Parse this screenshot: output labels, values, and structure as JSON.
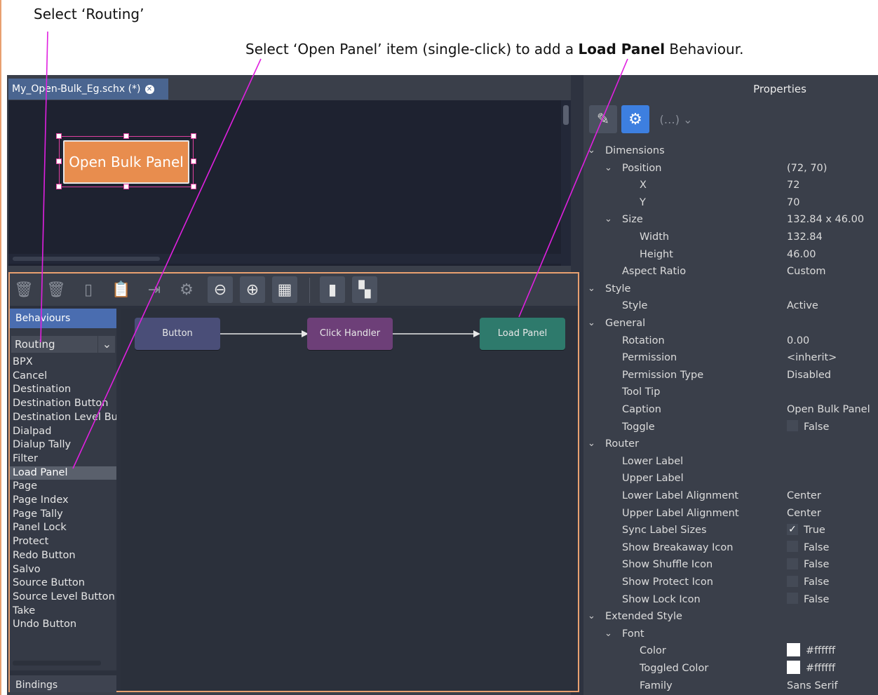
{
  "annotations": {
    "select_routing": "Select ‘Routing’",
    "select_open_panel_prefix": "Select ‘Open Panel’ item (single-click) to add a ",
    "select_open_panel_bold": "Load Panel",
    "select_open_panel_suffix": " Behaviour."
  },
  "document_tab": {
    "title": "My_Open-Bulk_Eg.schx (*)",
    "close_icon": "close-icon"
  },
  "canvas": {
    "button_caption": "Open Bulk Panel"
  },
  "toolbar": {
    "icons": [
      "trash-icon",
      "trash-clock-icon",
      "copy-icon",
      "paste-icon",
      "export-icon",
      "gear-icon",
      "zoom-out-icon",
      "zoom-in-icon",
      "fit-grid-icon",
      "align-icon",
      "window-icon"
    ]
  },
  "behaviours": {
    "tab_label": "Behaviours",
    "category": "Routing",
    "items": [
      "BPX",
      "Cancel",
      "Destination",
      "Destination Button",
      "Destination Level Butt",
      "Dialpad",
      "Dialup Tally",
      "Filter",
      "Load Panel",
      "Page",
      "Page Index",
      "Page Tally",
      "Panel Lock",
      "Protect",
      "Redo Button",
      "Salvo",
      "Source Button",
      "Source Level Button",
      "Take",
      "Undo Button"
    ],
    "selected": "Load Panel",
    "bindings_label": "Bindings"
  },
  "graph": {
    "nodes": [
      {
        "label": "Button",
        "color": "#4a4e78"
      },
      {
        "label": "Click Handler",
        "color": "#6d3f78"
      },
      {
        "label": "Load Panel",
        "color": "#2e7a6c"
      }
    ]
  },
  "properties": {
    "title": "Properties",
    "rows": [
      {
        "label": "Dimensions",
        "level": 0,
        "group": true,
        "value": ""
      },
      {
        "label": "Position",
        "level": 1,
        "group": true,
        "value": "(72, 70)"
      },
      {
        "label": "X",
        "level": 2,
        "value": "72"
      },
      {
        "label": "Y",
        "level": 2,
        "value": "70"
      },
      {
        "label": "Size",
        "level": 1,
        "group": true,
        "value": "132.84 x 46.00"
      },
      {
        "label": "Width",
        "level": 2,
        "value": "132.84"
      },
      {
        "label": "Height",
        "level": 2,
        "value": "46.00"
      },
      {
        "label": "Aspect Ratio",
        "level": 1,
        "value": "Custom"
      },
      {
        "label": "Style",
        "level": 0,
        "group": true,
        "value": ""
      },
      {
        "label": "Style",
        "level": 1,
        "value": "Active"
      },
      {
        "label": "General",
        "level": 0,
        "group": true,
        "value": ""
      },
      {
        "label": "Rotation",
        "level": 1,
        "value": "0.00"
      },
      {
        "label": "Permission",
        "level": 1,
        "value": "<inherit>"
      },
      {
        "label": "Permission Type",
        "level": 1,
        "value": "Disabled"
      },
      {
        "label": "Tool Tip",
        "level": 1,
        "value": ""
      },
      {
        "label": "Caption",
        "level": 1,
        "value": "Open Bulk Panel"
      },
      {
        "label": "Toggle",
        "level": 1,
        "checkbox": true,
        "checked": false,
        "value": "False"
      },
      {
        "label": "Router",
        "level": 0,
        "group": true,
        "value": ""
      },
      {
        "label": "Lower Label",
        "level": 1,
        "value": ""
      },
      {
        "label": "Upper Label",
        "level": 1,
        "value": ""
      },
      {
        "label": "Lower Label Alignment",
        "level": 1,
        "value": "Center"
      },
      {
        "label": "Upper Label Alignment",
        "level": 1,
        "value": "Center"
      },
      {
        "label": "Sync Label Sizes",
        "level": 1,
        "checkbox": true,
        "checked": true,
        "value": "True"
      },
      {
        "label": "Show Breakaway Icon",
        "level": 1,
        "checkbox": true,
        "checked": false,
        "value": "False"
      },
      {
        "label": "Show Shuffle Icon",
        "level": 1,
        "checkbox": true,
        "checked": false,
        "value": "False"
      },
      {
        "label": "Show Protect Icon",
        "level": 1,
        "checkbox": true,
        "checked": false,
        "value": "False"
      },
      {
        "label": "Show Lock Icon",
        "level": 1,
        "checkbox": true,
        "checked": false,
        "value": "False"
      },
      {
        "label": "Extended Style",
        "level": 0,
        "group": true,
        "value": ""
      },
      {
        "label": "Font",
        "level": 1,
        "group": true,
        "value": ""
      },
      {
        "label": "Color",
        "level": 2,
        "swatch": "#ffffff",
        "value": "#ffffff"
      },
      {
        "label": "Toggled Color",
        "level": 2,
        "swatch": "#ffffff",
        "value": "#ffffff"
      },
      {
        "label": "Family",
        "level": 2,
        "value": "Sans Serif"
      }
    ]
  },
  "colors": {
    "accent_orange": "#e8a070",
    "annotation_line": "#e020e0",
    "selection": "#e040a0",
    "button_orange": "#e88d4e"
  }
}
